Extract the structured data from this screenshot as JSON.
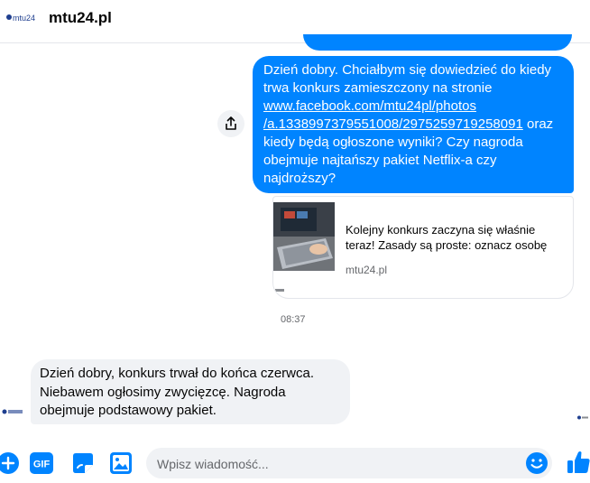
{
  "header": {
    "title": "mtu24.pl",
    "logo_text": "mtu24"
  },
  "outgoing": {
    "text_before": "Dzień dobry. Chciałbym się dowiedzieć do kiedy trwa konkurs zamieszczony na stronie ",
    "link_line1": "www.facebook.com/mtu24pl/photos",
    "link_line2": "/a.1338997379551008/2975259719258091",
    "text_after": " oraz kiedy będą ogłoszone wyniki? Czy nagroda obejmuje najtańszy pakiet Netflix-a czy najdroższy?"
  },
  "link_preview": {
    "description": "Kolejny konkurs zaczyna się właśnie teraz! Zasady są proste: oznacz osobę",
    "domain": "mtu24.pl"
  },
  "timestamp": "08:37",
  "incoming": {
    "text": "Dzień dobry, konkurs trwał do końca czerwca. Niebawem ogłosimy zwycięzcę. Nagroda obejmuje podstawowy pakiet."
  },
  "composer": {
    "placeholder": "Wpisz wiadomość...",
    "gif_label": "GIF"
  },
  "colors": {
    "accent": "#0084ff",
    "incoming_bubble": "#f0f2f5",
    "secondary_text": "#65676b"
  }
}
